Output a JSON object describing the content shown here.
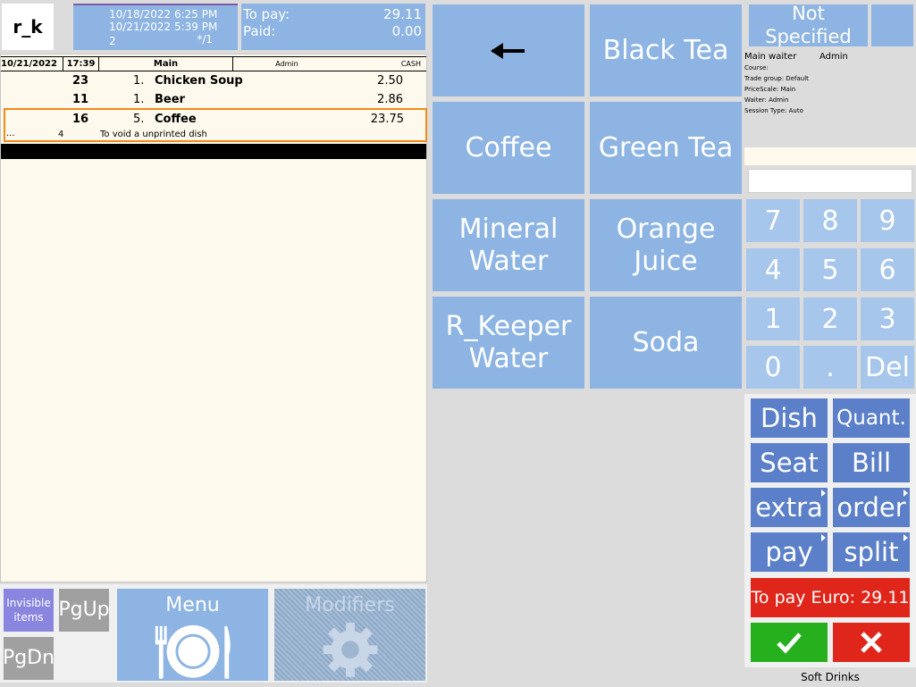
{
  "header": {
    "logo": "r_k",
    "datetime1": "10/18/2022 6:25 PM",
    "datetime2": "10/21/2022 5:39 PM",
    "guests": "2",
    "table_ref": "*/1",
    "to_pay_label": "To pay:",
    "to_pay_value": "29.11",
    "paid_label": "Paid:",
    "paid_value": "0.00"
  },
  "order_header": {
    "date": "10/21/2022",
    "time": "17:39",
    "menu": "Main",
    "waiter": "Admin",
    "payment": "CASH"
  },
  "order_items": [
    {
      "code": "23",
      "qty": "1.",
      "name": "Chicken Soup",
      "price": "2.50"
    },
    {
      "code": "11",
      "qty": "1.",
      "name": "Beer",
      "price": "2.86"
    },
    {
      "code": "16",
      "qty": "5.",
      "name": "Coffee",
      "price": "23.75"
    }
  ],
  "selected_note": {
    "dots": "...",
    "num": "4",
    "text": "To void a unprinted dish"
  },
  "bottom_left": {
    "invisible": "Invisible items",
    "pgup": "PgUp",
    "pgdn": "PgDn",
    "menu": "Menu",
    "modifiers": "Modifiers"
  },
  "dishes": {
    "back_icon": "arrow-left-icon",
    "black_tea": "Black Tea",
    "coffee": "Coffee",
    "green_tea": "Green Tea",
    "mineral_water_1": "Mineral",
    "mineral_water_2": "Water",
    "orange_juice_1": "Orange",
    "orange_juice_2": "Juice",
    "rkeeper_water_1": "R_Keeper",
    "rkeeper_water_2": "Water",
    "soda": "Soda"
  },
  "info": {
    "customer": "Not Specified",
    "main_waiter_label": "Main waiter",
    "main_waiter_value": "Admin",
    "course": "Course:",
    "trade_group": "Trade group: Default",
    "price_scale": "PriceScale: Main",
    "waiter": "Waiter: Admin",
    "session_type": "Session Type: Auto"
  },
  "keypad": [
    "7",
    "8",
    "9",
    "4",
    "5",
    "6",
    "1",
    "2",
    "3",
    "0",
    ".",
    "Del"
  ],
  "actions": {
    "dish": "Dish",
    "quant": "Quant.",
    "seat": "Seat",
    "bill": "Bill",
    "extra": "extra",
    "order": "order",
    "pay": "pay",
    "split": "split",
    "to_pay": "To pay Euro: 29.11",
    "ok": "✔",
    "cancel": "✕"
  },
  "category": "Soft Drinks",
  "colors": {
    "tile": "#8db4e2",
    "key": "#a7c6ec",
    "action": "#5b80c9",
    "pay_red": "#e0261a",
    "ok_green": "#27b01e",
    "selected_border": "#f08a1c"
  }
}
